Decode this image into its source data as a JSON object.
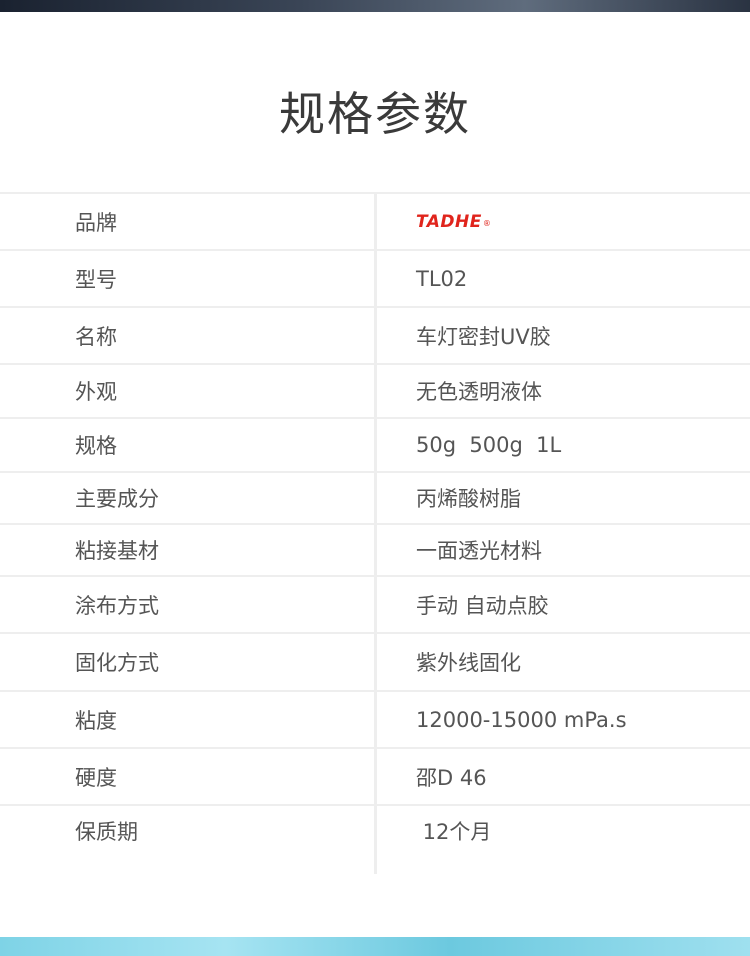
{
  "title": "规格参数",
  "brand": {
    "logo_text": "TADHE",
    "reg_mark": "®",
    "color": "#e0241c"
  },
  "rows": [
    {
      "label": "品牌",
      "value": ""
    },
    {
      "label": "型号",
      "value": "TL02"
    },
    {
      "label": "名称",
      "value": "车灯密封UV胶"
    },
    {
      "label": "外观",
      "value": "无色透明液体"
    },
    {
      "label": "规格",
      "value": "50g  500g  1L"
    },
    {
      "label": "主要成分",
      "value": "丙烯酸树脂"
    },
    {
      "label": "粘接基材",
      "value": "一面透光材料"
    },
    {
      "label": "涂布方式",
      "value": "手动 自动点胶"
    },
    {
      "label": "固化方式",
      "value": "紫外线固化"
    },
    {
      "label": "粘度",
      "value": "12000-15000 mPa.s"
    },
    {
      "label": "硬度",
      "value": "邵D 46"
    },
    {
      "label": "保质期",
      "value": " 12个月"
    }
  ]
}
